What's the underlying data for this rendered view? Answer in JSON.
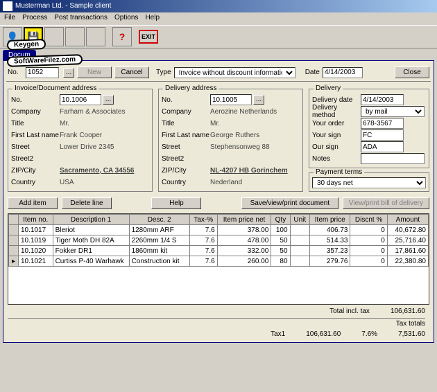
{
  "window": {
    "title": "Musterman Ltd. - Sample client"
  },
  "menu": [
    "File",
    "Process",
    "Post transactions",
    "Options",
    "Help"
  ],
  "toolbar": {
    "exit": "EXIT"
  },
  "tab": {
    "label": "Docum"
  },
  "top": {
    "no_label": "No.",
    "no_value": "1052",
    "new": "New",
    "cancel": "Cancel",
    "type_label": "Type",
    "type_value": "Invoice without discount information",
    "date_label": "Date",
    "date_value": "4/14/2003",
    "close": "Close"
  },
  "inv_addr": {
    "title": "Invoice/Document address",
    "no_label": "No.",
    "no": "10.1006",
    "company_label": "Company",
    "company": "Farham & Associates",
    "title_lbl": "Title",
    "title_val": "Mr.",
    "name_label": "First Last name",
    "name": "Frank Cooper",
    "street_label": "Street",
    "street": "Lower Drive 2345",
    "street2_label": "Street2",
    "street2": "",
    "zip_label": "ZIP/City",
    "zip": "Sacramento, CA 34556",
    "country_label": "Country",
    "country": "USA"
  },
  "del_addr": {
    "title": "Delivery address",
    "no_label": "No.",
    "no": "10.1005",
    "company_label": "Company",
    "company": "Aerozine Netherlands",
    "title_lbl": "Title",
    "title_val": "Mr.",
    "name_label": "First Last name",
    "name": "George Ruthers",
    "street_label": "Street",
    "street": "Stephensonweg 88",
    "street2_label": "Street2",
    "street2": "",
    "zip_label": "ZIP/City",
    "zip": "NL-4207 HB Gorinchem",
    "country_label": "Country",
    "country": "Nederland"
  },
  "delivery": {
    "title": "Delivery",
    "date_label": "Delivery date",
    "date": "4/14/2003",
    "method_label": "Delivery method",
    "method": "by mail",
    "order_label": "Your order",
    "order": "678-3567",
    "yoursign_label": "Your sign",
    "yoursign": "FC",
    "oursign_label": "Our sign",
    "oursign": "ADA",
    "notes_label": "Notes",
    "notes": "",
    "terms_label": "Payment terms",
    "terms": "30 days net"
  },
  "buttons": {
    "add_item": "Add item",
    "delete_line": "Delete line",
    "help": "Help",
    "save_view": "Save/view/print document",
    "view_bill": "View/print bill of delivery"
  },
  "cols": [
    "Item no.",
    "Description 1",
    "Desc. 2",
    "Tax-%",
    "Item price net",
    "Qty",
    "Unit",
    "Item price",
    "Discnt %",
    "Amount"
  ],
  "rows": [
    {
      "no": "10.1017",
      "d1": "Bleriot",
      "d2": "1280mm ARF",
      "tax": "7.6",
      "net": "378.00",
      "qty": "100",
      "unit": "",
      "price": "406.73",
      "disc": "0",
      "amt": "40,672.80"
    },
    {
      "no": "10.1019",
      "d1": "Tiger Moth DH 82A",
      "d2": "2260mm 1/4 S",
      "tax": "7.6",
      "net": "478.00",
      "qty": "50",
      "unit": "",
      "price": "514.33",
      "disc": "0",
      "amt": "25,716.40"
    },
    {
      "no": "10.1020",
      "d1": "Fokker DR1",
      "d2": "1860mm kit",
      "tax": "7.6",
      "net": "332.00",
      "qty": "50",
      "unit": "",
      "price": "357.23",
      "disc": "0",
      "amt": "17,861.60"
    },
    {
      "no": "10.1021",
      "d1": "Curtiss P-40 Warhawk",
      "d2": "Construction kit",
      "tax": "7.6",
      "net": "260.00",
      "qty": "80",
      "unit": "",
      "price": "279.76",
      "disc": "0",
      "amt": "22,380.80"
    }
  ],
  "totals": {
    "total_label": "Total incl. tax",
    "total": "106,631.60",
    "tax_totals_label": "Tax totals",
    "tax1_label": "Tax1",
    "tax1_base": "106,631.60",
    "tax1_pct": "7.6%",
    "tax1_amt": "7,531.60"
  },
  "watermark": {
    "l1": "Keygen",
    "l2": "SoftWareFilez.com"
  }
}
